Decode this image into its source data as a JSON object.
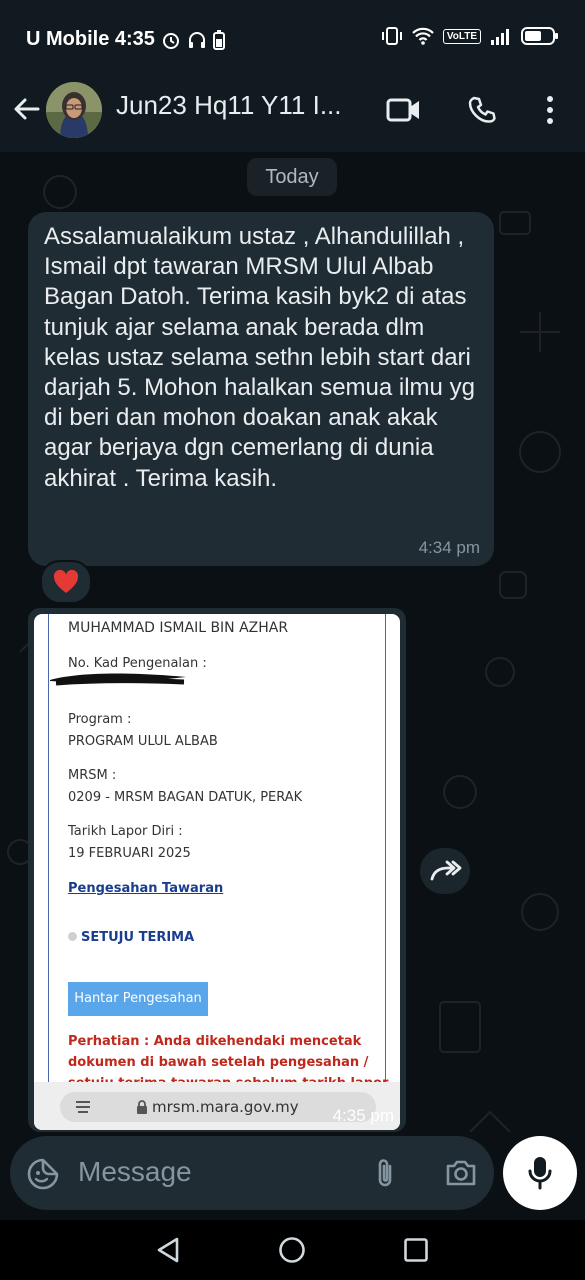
{
  "status_bar": {
    "carrier_time": "U Mobile 4:35",
    "volte": "VoLTE",
    "battery_level": 0.55
  },
  "header": {
    "title": "Jun23 Hq11 Y11 I..."
  },
  "chat": {
    "date_chip": "Today",
    "message": {
      "text": "Assalamualaikum ustaz , Alhandulillah , Ismail dpt tawaran MRSM Ulul Albab Bagan Datoh. Terima kasih byk2 di atas tunjuk ajar selama anak berada dlm kelas ustaz selama sethn lebih start dari darjah 5. Mohon halalkan semua ilmu yg di beri dan mohon doakan anak akak agar berjaya dgn cemerlang di dunia akhirat . Terima kasih.",
      "time": "4:34 pm",
      "reaction": "❤️"
    },
    "image_message": {
      "name": "MUHAMMAD ISMAIL BIN AZHAR",
      "id_label": "No. Kad Pengenalan :",
      "program_label": "Program :",
      "program_value": "PROGRAM ULUL ALBAB",
      "mrsm_label": "MRSM :",
      "mrsm_value": "0209 - MRSM BAGAN DATUK, PERAK",
      "date_label": "Tarikh Lapor Diri :",
      "date_value": "19 FEBRUARI 2025",
      "confirm_link": "Pengesahan Tawaran",
      "agree": "SETUJU TERIMA",
      "submit_button": "Hantar Pengesahan",
      "warning_line1": "Perhatian : Anda dikehendaki mencetak",
      "warning_line2": "dokumen di bawah setelah pengesahan /",
      "warning_line3": "setuju terima tawaran sebelum tarikh lapor",
      "url": "mrsm.mara.gov.my",
      "time": "4:35 pm"
    }
  },
  "input": {
    "placeholder": "Message"
  }
}
